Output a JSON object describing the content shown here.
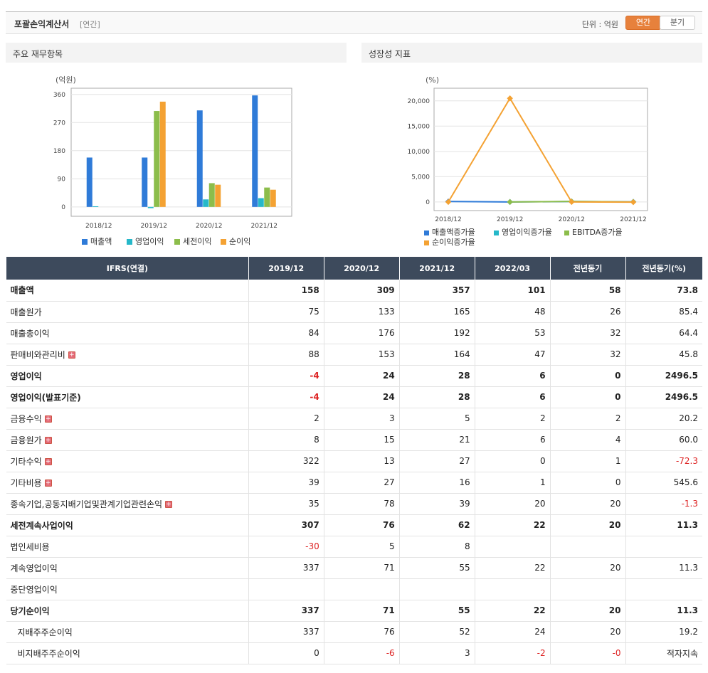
{
  "header": {
    "title": "포괄손익계산서",
    "period_tag": "[연간]",
    "unit_label": "단위 : 억원",
    "btn_annual": "연간",
    "btn_quarter": "분기"
  },
  "left_chart": {
    "panel_title": "주요 재무항목",
    "unit": "(억원)"
  },
  "right_chart": {
    "panel_title": "성장성 지표",
    "unit": "(%)"
  },
  "chart_data": [
    {
      "type": "bar",
      "title": "주요 재무항목",
      "ylabel": "(억원)",
      "categories": [
        "2018/12",
        "2019/12",
        "2020/12",
        "2021/12"
      ],
      "ylim": [
        -30,
        380
      ],
      "yticks": [
        0,
        90,
        180,
        270,
        360
      ],
      "series": [
        {
          "name": "매출액",
          "color": "#2f7bd8",
          "values": [
            158,
            158,
            309,
            357
          ]
        },
        {
          "name": "영업이익",
          "color": "#26b8c9",
          "values": [
            2,
            -4,
            24,
            28
          ]
        },
        {
          "name": "세전이익",
          "color": "#8cbd4b",
          "values": [
            null,
            307,
            76,
            62
          ]
        },
        {
          "name": "순이익",
          "color": "#f4a233",
          "values": [
            null,
            337,
            71,
            55
          ]
        }
      ],
      "legend": "bottom"
    },
    {
      "type": "line",
      "title": "성장성 지표",
      "ylabel": "(%)",
      "categories": [
        "2018/12",
        "2019/12",
        "2020/12",
        "2021/12"
      ],
      "ylim": [
        -1700,
        22500
      ],
      "yticks": [
        0,
        5000,
        10000,
        15000,
        20000
      ],
      "ytick_labels": [
        "0",
        "5,000",
        "10,000",
        "15,000",
        "20,000"
      ],
      "series": [
        {
          "name": "매출액증가율",
          "color": "#2f7bd8",
          "values": [
            100,
            0,
            95,
            16
          ]
        },
        {
          "name": "영업이익증가율",
          "color": "#26b8c9",
          "values": [
            null,
            null,
            null,
            17
          ]
        },
        {
          "name": "EBITDA증가율",
          "color": "#8cbd4b",
          "values": [
            null,
            0,
            120,
            0
          ]
        },
        {
          "name": "순이익증가율",
          "color": "#f4a233",
          "values": [
            0,
            20500,
            0,
            -22
          ]
        }
      ],
      "legend": "bottom"
    }
  ],
  "table": {
    "headers": [
      "IFRS(연결)",
      "2019/12",
      "2020/12",
      "2021/12",
      "2022/03",
      "전년동기",
      "전년동기(%)"
    ],
    "rows": [
      {
        "label": "매출액",
        "bold": true,
        "expand": false,
        "indent": false,
        "cells": [
          "158",
          "309",
          "357",
          "101",
          "58",
          "73.8"
        ]
      },
      {
        "label": "매출원가",
        "bold": false,
        "expand": false,
        "indent": false,
        "cells": [
          "75",
          "133",
          "165",
          "48",
          "26",
          "85.4"
        ]
      },
      {
        "label": "매출총이익",
        "bold": false,
        "expand": false,
        "indent": false,
        "cells": [
          "84",
          "176",
          "192",
          "53",
          "32",
          "64.4"
        ]
      },
      {
        "label": "판매비와관리비",
        "bold": false,
        "expand": true,
        "indent": false,
        "cells": [
          "88",
          "153",
          "164",
          "47",
          "32",
          "45.8"
        ]
      },
      {
        "label": "영업이익",
        "bold": true,
        "expand": false,
        "indent": false,
        "cells": [
          "-4",
          "24",
          "28",
          "6",
          "0",
          "2496.5"
        ]
      },
      {
        "label": "영업이익(발표기준)",
        "bold": true,
        "expand": false,
        "indent": false,
        "cells": [
          "-4",
          "24",
          "28",
          "6",
          "0",
          "2496.5"
        ]
      },
      {
        "label": "금융수익",
        "bold": false,
        "expand": true,
        "indent": false,
        "cells": [
          "2",
          "3",
          "5",
          "2",
          "2",
          "20.2"
        ]
      },
      {
        "label": "금융원가",
        "bold": false,
        "expand": true,
        "indent": false,
        "cells": [
          "8",
          "15",
          "21",
          "6",
          "4",
          "60.0"
        ]
      },
      {
        "label": "기타수익",
        "bold": false,
        "expand": true,
        "indent": false,
        "cells": [
          "322",
          "13",
          "27",
          "0",
          "1",
          "-72.3"
        ]
      },
      {
        "label": "기타비용",
        "bold": false,
        "expand": true,
        "indent": false,
        "cells": [
          "39",
          "27",
          "16",
          "1",
          "0",
          "545.6"
        ]
      },
      {
        "label": "종속기업,공동지배기업및관계기업관련손익",
        "bold": false,
        "expand": true,
        "indent": false,
        "cells": [
          "35",
          "78",
          "39",
          "20",
          "20",
          "-1.3"
        ]
      },
      {
        "label": "세전계속사업이익",
        "bold": true,
        "expand": false,
        "indent": false,
        "cells": [
          "307",
          "76",
          "62",
          "22",
          "20",
          "11.3"
        ]
      },
      {
        "label": "법인세비용",
        "bold": false,
        "expand": false,
        "indent": false,
        "cells": [
          "-30",
          "5",
          "8",
          "",
          "",
          ""
        ]
      },
      {
        "label": "계속영업이익",
        "bold": false,
        "expand": false,
        "indent": false,
        "cells": [
          "337",
          "71",
          "55",
          "22",
          "20",
          "11.3"
        ]
      },
      {
        "label": "중단영업이익",
        "bold": false,
        "expand": false,
        "indent": false,
        "cells": [
          "",
          "",
          "",
          "",
          "",
          ""
        ]
      },
      {
        "label": "당기순이익",
        "bold": true,
        "expand": false,
        "indent": false,
        "cells": [
          "337",
          "71",
          "55",
          "22",
          "20",
          "11.3"
        ]
      },
      {
        "label": "지배주주순이익",
        "bold": false,
        "expand": false,
        "indent": true,
        "cells": [
          "337",
          "76",
          "52",
          "24",
          "20",
          "19.2"
        ]
      },
      {
        "label": "비지배주주순이익",
        "bold": false,
        "expand": false,
        "indent": true,
        "cells": [
          "0",
          "-6",
          "3",
          "-2",
          "-0",
          "적자지속"
        ]
      }
    ]
  }
}
